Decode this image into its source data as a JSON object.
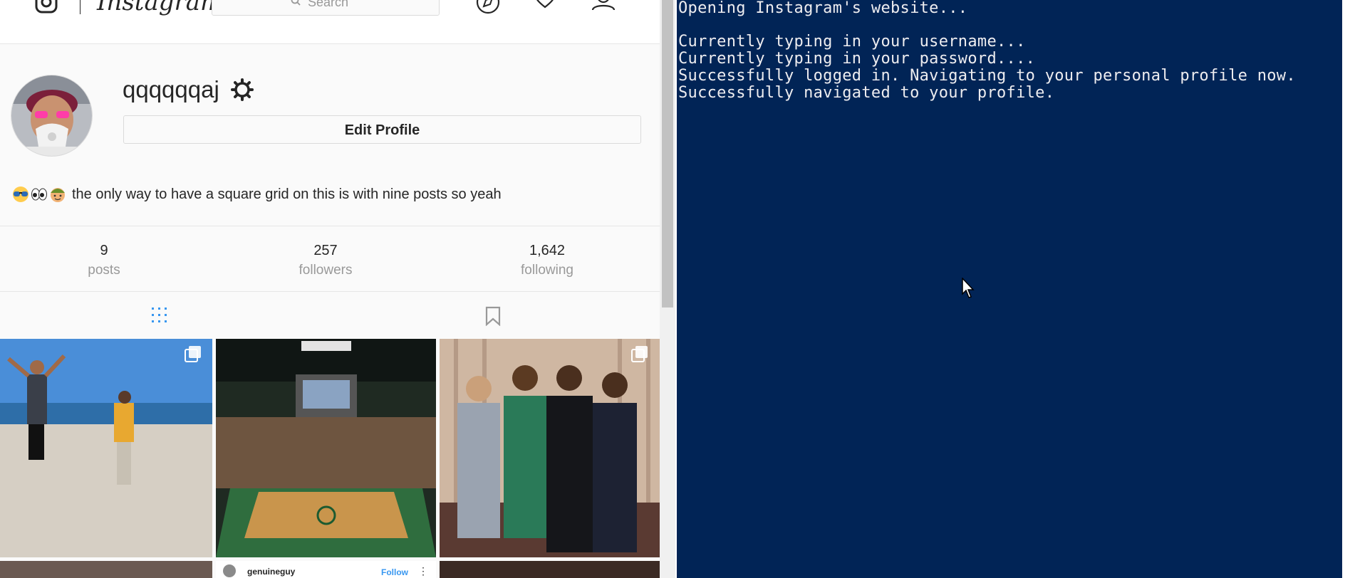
{
  "instagram": {
    "logo_text": "Instagram",
    "search_placeholder": "Search",
    "username": "qqqqqqaj",
    "edit_profile_label": "Edit Profile",
    "bio_emojis": [
      "sunglasses-emoji",
      "eyes-emoji",
      "face-with-cap-emoji"
    ],
    "bio_text": "the only way to have a square grid on this is with nine posts so yeah",
    "stats": [
      {
        "value": "9",
        "label": "posts"
      },
      {
        "value": "257",
        "label": "followers"
      },
      {
        "value": "1,642",
        "label": "following"
      }
    ],
    "posts_row2": {
      "username": "genuineguy",
      "follow_label": "Follow"
    },
    "nav_icons": [
      "compass-icon",
      "heart-icon",
      "user-icon"
    ],
    "accent_color": "#3897f0"
  },
  "terminal": {
    "background": "#012456",
    "lines": [
      "Opening Instagram's website...",
      "",
      "Currently typing in your username...",
      "Currently typing in your password....",
      "Successfully logged in. Navigating to your personal profile now.",
      "Successfully navigated to your profile."
    ]
  }
}
